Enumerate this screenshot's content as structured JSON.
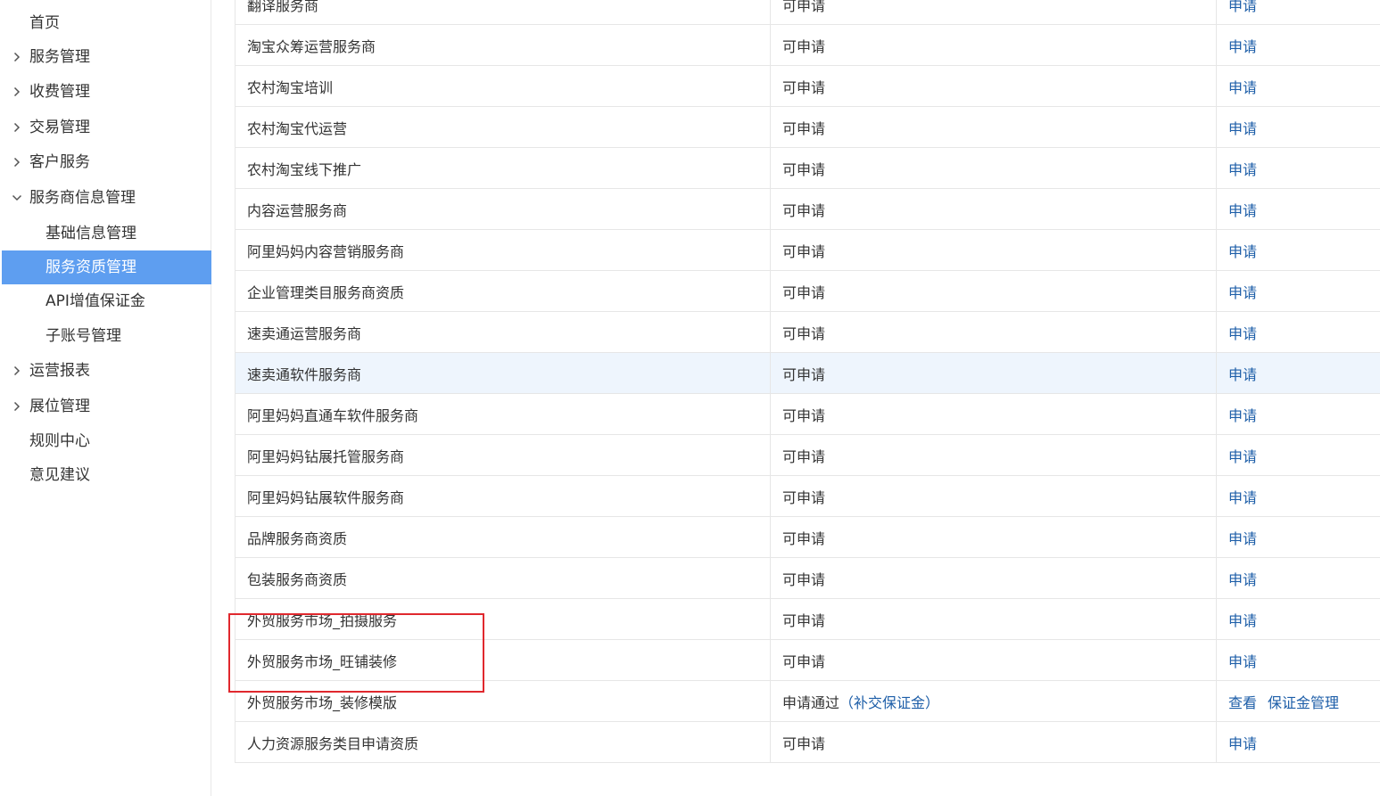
{
  "sidebar": {
    "items": [
      {
        "label": "首页",
        "chevron": "none"
      },
      {
        "label": "服务管理",
        "chevron": "right"
      },
      {
        "label": "收费管理",
        "chevron": "right"
      },
      {
        "label": "交易管理",
        "chevron": "right"
      },
      {
        "label": "客户服务",
        "chevron": "right"
      },
      {
        "label": "服务商信息管理",
        "chevron": "down"
      },
      {
        "label": "基础信息管理",
        "chevron": "none"
      },
      {
        "label": "服务资质管理",
        "chevron": "none"
      },
      {
        "label": "API增值保证金",
        "chevron": "none"
      },
      {
        "label": "子账号管理",
        "chevron": "none"
      },
      {
        "label": "运营报表",
        "chevron": "right"
      },
      {
        "label": "展位管理",
        "chevron": "right"
      },
      {
        "label": "规则中心",
        "chevron": "none"
      },
      {
        "label": "意见建议",
        "chevron": "none"
      }
    ]
  },
  "table": {
    "rows": [
      {
        "name": "翻译服务商",
        "status": "可申请",
        "action": "申请"
      },
      {
        "name": "淘宝众筹运营服务商",
        "status": "可申请",
        "action": "申请"
      },
      {
        "name": "农村淘宝培训",
        "status": "可申请",
        "action": "申请"
      },
      {
        "name": "农村淘宝代运营",
        "status": "可申请",
        "action": "申请"
      },
      {
        "name": "农村淘宝线下推广",
        "status": "可申请",
        "action": "申请"
      },
      {
        "name": "内容运营服务商",
        "status": "可申请",
        "action": "申请"
      },
      {
        "name": "阿里妈妈内容营销服务商",
        "status": "可申请",
        "action": "申请"
      },
      {
        "name": "企业管理类目服务商资质",
        "status": "可申请",
        "action": "申请"
      },
      {
        "name": "速卖通运营服务商",
        "status": "可申请",
        "action": "申请"
      },
      {
        "name": "速卖通软件服务商",
        "status": "可申请",
        "action": "申请"
      },
      {
        "name": "阿里妈妈直通车软件服务商",
        "status": "可申请",
        "action": "申请"
      },
      {
        "name": "阿里妈妈钻展托管服务商",
        "status": "可申请",
        "action": "申请"
      },
      {
        "name": "阿里妈妈钻展软件服务商",
        "status": "可申请",
        "action": "申请"
      },
      {
        "name": "品牌服务商资质",
        "status": "可申请",
        "action": "申请"
      },
      {
        "name": "包装服务商资质",
        "status": "可申请",
        "action": "申请"
      },
      {
        "name": "外贸服务市场_拍摄服务",
        "status": "可申请",
        "action": "申请"
      },
      {
        "name": "外贸服务市场_旺铺装修",
        "status": "可申请",
        "action": "申请"
      },
      {
        "name": "外贸服务市场_装修模版",
        "status": "申请通过",
        "status_open": "（",
        "status_link": "补交保证金",
        "status_close": "）",
        "action": "查看",
        "action2": "保证金管理"
      },
      {
        "name": "人力资源服务类目申请资质",
        "status": "可申请",
        "action": "申请"
      }
    ]
  },
  "colors": {
    "active_bg": "#5e9ef0",
    "link": "#1d5ea8",
    "highlight_row": "#eef5fd",
    "annotation_border": "#e0282e"
  }
}
